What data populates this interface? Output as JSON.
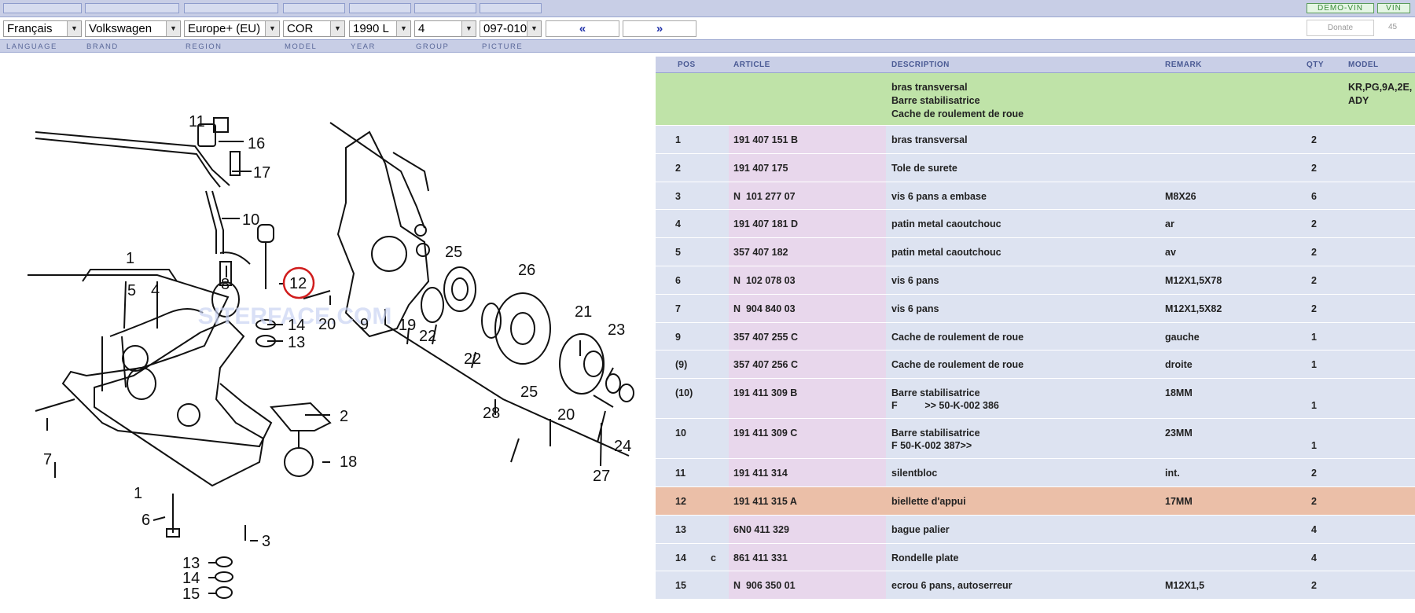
{
  "toolbar": {
    "demo_vin": "DEMO-VIN",
    "vin": "VIN",
    "donate": "Donate",
    "count": "45"
  },
  "selectors": {
    "language": "Français",
    "brand": "Volkswagen",
    "region": "Europe+ (EU)",
    "model": "COR",
    "year": "1990  L",
    "group": "4",
    "picture": "097-010",
    "prev": "«",
    "next": "»"
  },
  "labels": {
    "language": "LANGUAGE",
    "brand": "BRAND",
    "region": "REGION",
    "model": "MODEL",
    "year": "YEAR",
    "group": "GROUP",
    "picture": "PICTURE"
  },
  "diagram": {
    "watermark": "SITERFACE.COM",
    "callouts": [
      "11",
      "16",
      "17",
      "10",
      "1",
      "5",
      "4",
      "8",
      "12",
      "20",
      "14",
      "13",
      "9",
      "19",
      "22",
      "25",
      "22",
      "26",
      "21",
      "23",
      "25",
      "28",
      "20",
      "2",
      "18",
      "7",
      "1",
      "6",
      "3",
      "13",
      "14",
      "15",
      "27",
      "24"
    ],
    "highlighted": "12"
  },
  "table": {
    "headers": {
      "pos": "POS",
      "article": "ARTICLE",
      "description": "DESCRIPTION",
      "remark": "REMARK",
      "qty": "QTY",
      "model": "MODEL"
    },
    "header_row": {
      "desc1": "bras transversal",
      "desc2": "Barre stabilisatrice",
      "desc3": "Cache de roulement de roue",
      "model1": "KR,PG,9A,2E,",
      "model2": "ADY"
    },
    "rows": [
      {
        "pos": "1",
        "flag": "",
        "article": "191 407 151 B",
        "desc": "bras transversal",
        "desc2": "",
        "remark": "",
        "qty": "2"
      },
      {
        "pos": "2",
        "flag": "",
        "article": "191 407 175",
        "desc": "Tole de surete",
        "desc2": "",
        "remark": "",
        "qty": "2"
      },
      {
        "pos": "3",
        "flag": "",
        "article": "N  101 277 07",
        "desc": "vis 6 pans a embase",
        "desc2": "",
        "remark": "M8X26",
        "qty": "6"
      },
      {
        "pos": "4",
        "flag": "",
        "article": "191 407 181 D",
        "desc": "patin metal caoutchouc",
        "desc2": "",
        "remark": "ar",
        "qty": "2"
      },
      {
        "pos": "5",
        "flag": "",
        "article": "357 407 182",
        "desc": "patin metal caoutchouc",
        "desc2": "",
        "remark": "av",
        "qty": "2"
      },
      {
        "pos": "6",
        "flag": "",
        "article": "N  102 078 03",
        "desc": "vis 6 pans",
        "desc2": "",
        "remark": "M12X1,5X78",
        "qty": "2"
      },
      {
        "pos": "7",
        "flag": "",
        "article": "N  904 840 03",
        "desc": "vis 6 pans",
        "desc2": "",
        "remark": "M12X1,5X82",
        "qty": "2"
      },
      {
        "pos": "9",
        "flag": "",
        "article": "357 407 255 C",
        "desc": "Cache de roulement de roue",
        "desc2": "",
        "remark": "gauche",
        "qty": "1"
      },
      {
        "pos": "(9)",
        "flag": "",
        "article": "357 407 256 C",
        "desc": "Cache de roulement de roue",
        "desc2": "",
        "remark": "droite",
        "qty": "1"
      },
      {
        "pos": "(10)",
        "flag": "",
        "article": "191 411 309 B",
        "desc": "Barre stabilisatrice",
        "desc2": "F          >> 50-K-002 386",
        "remark": "18MM",
        "qty": "1"
      },
      {
        "pos": "10",
        "flag": "",
        "article": "191 411 309 C",
        "desc": "Barre stabilisatrice",
        "desc2": "F 50-K-002 387>>",
        "remark": "23MM",
        "qty": "1"
      },
      {
        "pos": "11",
        "flag": "",
        "article": "191 411 314",
        "desc": "silentbloc",
        "desc2": "",
        "remark": "int.",
        "qty": "2"
      },
      {
        "pos": "12",
        "flag": "",
        "article": "191 411 315 A",
        "desc": "biellette d'appui",
        "desc2": "",
        "remark": "17MM",
        "qty": "2"
      },
      {
        "pos": "13",
        "flag": "",
        "article": "6N0 411 329",
        "desc": "bague palier",
        "desc2": "",
        "remark": "",
        "qty": "4"
      },
      {
        "pos": "14",
        "flag": "c",
        "article": "861 411 331",
        "desc": "Rondelle plate",
        "desc2": "",
        "remark": "",
        "qty": "4"
      },
      {
        "pos": "15",
        "flag": "",
        "article": "N  906 350 01",
        "desc": "ecrou 6 pans, autoserreur",
        "desc2": "",
        "remark": "M12X1,5",
        "qty": "2"
      }
    ]
  }
}
